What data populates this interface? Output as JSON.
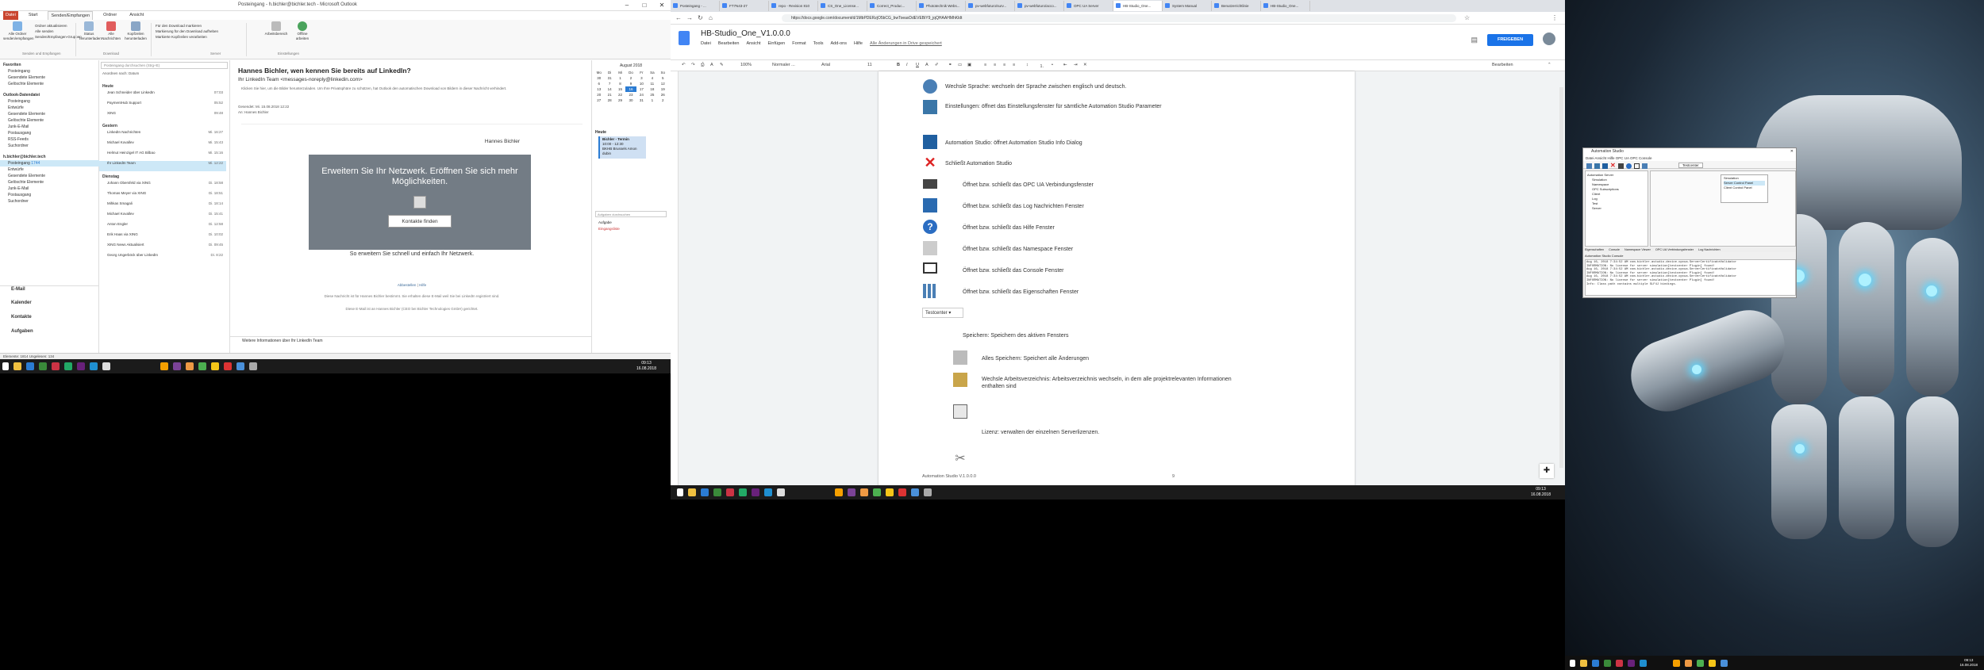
{
  "outlook": {
    "title": "Posteingang - h.bichler@bichler.tech - Microsoft Outlook",
    "tabs": [
      "Datei",
      "Start",
      "Senden/Empfangen",
      "Ordner",
      "Ansicht"
    ],
    "ribbon": {
      "g1": [
        "Alle Ordner",
        "senden/empfangen"
      ],
      "g1_items": [
        "Ordner aktualisieren",
        "Alle senden",
        "Senden/Empfangen-Gruppen"
      ],
      "g1_label": "Senden und Empfangen",
      "g2": [
        "Status",
        "herunterladen"
      ],
      "g3": [
        "Alle",
        "Nachrichten",
        "abbrechen"
      ],
      "g4": [
        "Kopfzeilen",
        "herunterladen"
      ],
      "g2_label": "Download",
      "g5_items": [
        "Für den Download markieren",
        "Markierung für den Download aufheben",
        "Markierte Kopfzeilen verarbeiten"
      ],
      "g5_label": "Server",
      "g6": [
        "Offline",
        "arbeiten"
      ],
      "g6_label": "Einstellungen",
      "g7": "Arbeitsbereich"
    },
    "nav": {
      "favoriten": "Favoriten",
      "fav_items": [
        "Posteingang",
        "Gesendete Elemente",
        "Gelöschte Elemente"
      ],
      "acct1": "Outlook-Datendatei",
      "acct1_items": [
        "Posteingang",
        "Entwürfe",
        "Gesendete Elemente",
        "Gelöschte Elemente",
        "Junk-E-Mail",
        "Postausgang",
        "RSS-Feeds",
        "Suchordner"
      ],
      "acct2": "h.bichler@bichler.tech",
      "acct2_items": [
        "Posteingang",
        "Entwürfe",
        "Gesendete Elemente",
        "Gelöschte Elemente",
        "Junk-E-Mail",
        "Postausgang",
        "Suchordner"
      ],
      "inbox_count": "1744",
      "big": [
        "E-Mail",
        "Kalender",
        "Kontakte",
        "Aufgaben"
      ]
    },
    "list": {
      "search": "Posteingang durchsuchen (Strg+E)",
      "sort": "Anordnen nach: Datum",
      "group_today": "Heute",
      "group_yesterday": "Gestern",
      "group_tue": "Dienstag",
      "items": [
        {
          "from": "Jean Schneider über LinkedIn",
          "date": "07:03"
        },
        {
          "from": "PaymentHub Support",
          "date": "05:52"
        },
        {
          "from": "XING",
          "date": "09:48"
        },
        {
          "from": "LinkedIn Nachrichten",
          "date": "Mi. 16:27"
        },
        {
          "from": "Michael Kovallev",
          "date": "Mi. 15:43"
        },
        {
          "from": "Helmut Heinzigel IT AG Bilbao",
          "date": "Mi. 15:16"
        },
        {
          "from": "Ihr LinkedIn Team",
          "date": "Mi. 12:22"
        },
        {
          "from": "Johann Obersfeld via XING",
          "date": "Di. 18:58"
        },
        {
          "from": "Thomas Meyer via XING",
          "date": "Di. 18:51"
        },
        {
          "from": "Mihkas Smagali",
          "date": "Di. 18:14"
        },
        {
          "from": "Michael Kovallev",
          "date": "Di. 15:41"
        },
        {
          "from": "Anton Engler",
          "date": "Di. 12:58"
        },
        {
          "from": "Erik Haas via XING",
          "date": "Di. 10:02"
        },
        {
          "from": "XING News Aktualisiert",
          "date": "Di. 09:45"
        },
        {
          "from": "Georg Ungerböck über LinkedIn",
          "date": "Di. 8:22"
        }
      ]
    },
    "mail": {
      "subject": "Hannes Bichler, wen kennen Sie bereits auf LinkedIn?",
      "from": "Ihr LinkedIn Team <messages-noreply@linkedin.com>",
      "info": "Klicken Sie hier, um die Bilder herunterzuladen. Um Ihre Privatsphäre zu schützen, hat Outlook den automatischen Download von Bildern in dieser Nachricht verhindert.",
      "sent_label": "Gesendet:",
      "sent": "Mi. 15.08.2018 12:22",
      "to_label": "An:",
      "to": "Hannes Bichler",
      "card_name": "Hannes Bichler",
      "card_head": "Erweitern Sie Ihr Netzwerk. Eröffnen Sie sich mehr Möglichkeiten.",
      "card_btn": "Kontakte finden",
      "tagline": "So erweitern Sie schnell und einfach Ihr Netzwerk.",
      "link1": "Abbestellen",
      "link2": "Hilfe",
      "fine1": "Diese Nachricht ist für Hannes Bichler bestimmt. Sie erhalten diese E-Mail weil Sie bei LinkedIn registriert sind.",
      "fine2": "Diese E-Mail ist an Hannes Bichler (CEO bei Bichler Technologies GmbH) gerichtet.",
      "infobar": "Weitere Informationen über Ihr LinkedIn Team"
    },
    "todo": {
      "month": "August 2018",
      "days": [
        "Mo",
        "Di",
        "Mi",
        "Do",
        "Fr",
        "Sa",
        "So"
      ],
      "dates": [
        "30",
        "31",
        "1",
        "2",
        "3",
        "4",
        "5",
        "6",
        "7",
        "8",
        "9",
        "10",
        "11",
        "12",
        "13",
        "14",
        "15",
        "16",
        "17",
        "18",
        "19",
        "20",
        "21",
        "22",
        "23",
        "24",
        "25",
        "26",
        "27",
        "28",
        "29",
        "30",
        "31",
        "1",
        "2"
      ],
      "today": "16",
      "today_label": "Heute",
      "apt_title": "Bichler - Termin",
      "apt_time": "10:00 - 12:30",
      "apt_loc": "BKHB Brussels Amon dubin",
      "tasks_search": "Aufgaben durchsuchen",
      "tasks_label": "Aufgabe",
      "tasks_item": "Eingangsliste"
    },
    "status": "Elemente: 1814    Ungelesen: 134"
  },
  "taskbar1": {
    "time": "09:13",
    "date": "16.08.2018"
  },
  "chrome": {
    "tabs": [
      "Posteingang - ...",
      "FT7N43-27",
      "repo - Revision 810",
      "CS_One_License...",
      "Correct_Produc...",
      "Phototechnik Webs...",
      "pv-webfuturo/surv...",
      "pv-webfuturo/acco...",
      "OPC UA Server",
      "HB-Studio_One...",
      "System Manual",
      "Benutzerrichtlinie",
      "HB-Studio_One..."
    ],
    "active_tab": "HB-Studio_One...",
    "url": "https://docs.google.com/document/d/1MbPDERzjO5bCG_bwToeaxDdEVEBiY9_jqQHAAHMhKldt",
    "doc_title": "HB-Studio_One_V1.0.0.0",
    "menu": [
      "Datei",
      "Bearbeiten",
      "Ansicht",
      "Einfügen",
      "Format",
      "Tools",
      "Add-ons",
      "Hilfe"
    ],
    "saved": "Alle Änderungen in Drive gespeichert",
    "share": "FREIGEBEN",
    "zoom": "100%",
    "style": "Normaler ...",
    "font": "Arial",
    "size": "11",
    "edit_mode": "Bearbeiten",
    "rows": [
      "Wechsle Sprache: wechseln der Sprache zwischen englisch und deutsch.",
      "Einstellungen: öffnet das Einstellungsfenster für sämtliche Automation Studio Parameter",
      "Automation Studio: öffnet Automation Studio Info Dialog",
      "Schließt Automation Studio",
      "Öffnet bzw. schließt das OPC UA Verbindungsfenster",
      "Öffnet bzw. schließt das Log Nachrichten Fenster",
      "Öffnet bzw. schließt das Hilfe Fenster",
      "Öffnet bzw. schließt das Namespace Fenster",
      "Öffnet bzw. schließt das Console Fenster",
      "Öffnet bzw. schließt das Eigenschaften Fenster"
    ],
    "dropdown": "Testcenter",
    "save_heading": "Speichern: Speichern des aktiven Fensters",
    "rows2": [
      "Alles Speichern: Speichert alle Änderungen",
      "Wechsle Arbeitsverzeichnis: Arbeitsverzeichnis wechseln, in dem alle projektrelevanten Informationen enthalten sind",
      "Lizenz:  verwalten der einzelnen Serverlizenzen."
    ],
    "footer_left": "Automation Studio V.1.0.0.0",
    "footer_page": "9"
  },
  "taskbar2": {
    "time": "09:13",
    "date": "16.08.2018"
  },
  "desktop": {
    "as_title": "Automation Studio",
    "as_menu": "Datei  Ansicht  Hilfe  OPC UA  OPC  Console",
    "as_tree_root": "Automation Server",
    "as_tree": [
      "Simulation",
      "Namespace",
      "OPC Subscriptions",
      "Client",
      "Log",
      "Test",
      "Server"
    ],
    "as_popup": [
      "Simulation",
      "Server Control Panel",
      "Client Control Panel"
    ],
    "as_dropdown": "Testcenter",
    "as_console": "Automation Studio Console",
    "as_tabs": [
      "Eigenschaften",
      "Console",
      "Namespace Viewer",
      "OPC UA Verbindungsfenster",
      "Log Nachrichten"
    ],
    "as_log": [
      "Aug 16, 2018 7:34:52 AM com.bichler.astudio.device.opcua.ServerCertificateValidator",
      "INFORMATION: No license for server simulation[testcenter Plugin] found!",
      "Aug 16, 2018 7:34:52 AM com.bichler.astudio.device.opcua.ServerCertificateValidator",
      "INFORMATION: No license for server simulation[testcenter Plugin] found!",
      "Aug 16, 2018 7:34:52 AM com.bichler.astudio.device.opcua.ServerCertificateValidator",
      "INFORMATION: No license for server simulation[testcenter Plugin] found!",
      "Info: Class path contains multiple SLF4J bindings."
    ],
    "clock": "16.08.2018",
    "time": "09:13"
  },
  "colors": {
    "outlook_accent": "#c9452f",
    "docs_blue": "#1a73e8",
    "linkedin_gray": "#737c85"
  }
}
